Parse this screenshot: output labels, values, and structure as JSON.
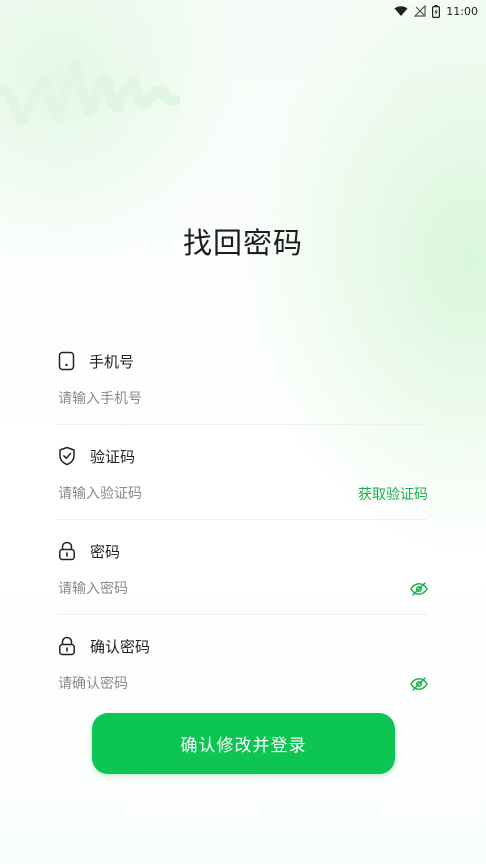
{
  "status_bar": {
    "time": "11:00",
    "wifi_icon": "wifi-icon",
    "signal_icon": "no-signal-icon",
    "battery_icon": "battery-charging-icon"
  },
  "page": {
    "title": "找回密码"
  },
  "form": {
    "phone": {
      "label": "手机号",
      "placeholder": "请输入手机号",
      "icon": "phone-icon"
    },
    "code": {
      "label": "验证码",
      "placeholder": "请输入验证码",
      "icon": "shield-check-icon",
      "get_code_label": "获取验证码"
    },
    "password": {
      "label": "密码",
      "placeholder": "请输入密码",
      "icon": "lock-icon"
    },
    "confirm_password": {
      "label": "确认密码",
      "placeholder": "请确认密码",
      "icon": "lock-icon"
    },
    "submit_label": "确认修改并登录"
  },
  "colors": {
    "accent": "#0cc553",
    "accent_text": "#1ab14a"
  }
}
